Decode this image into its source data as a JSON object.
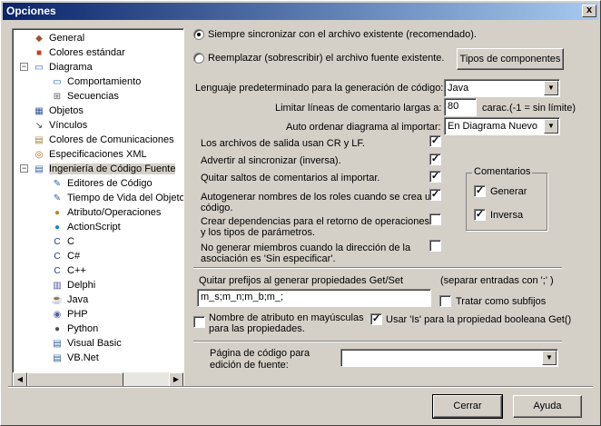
{
  "window": {
    "title": "Opciones",
    "close_glyph": "x"
  },
  "tree": {
    "items": [
      {
        "label": "General",
        "icon": "general-icon"
      },
      {
        "label": "Colores estándar",
        "icon": "colors-icon"
      },
      {
        "label": "Diagrama",
        "icon": "diagram-icon"
      },
      {
        "label": "Comportamiento",
        "icon": "behavior-icon"
      },
      {
        "label": "Secuencias",
        "icon": "sequence-icon"
      },
      {
        "label": "Objetos",
        "icon": "objects-icon"
      },
      {
        "label": "Vínculos",
        "icon": "links-icon"
      },
      {
        "label": "Colores de Comunicaciones",
        "icon": "comm-colors-icon"
      },
      {
        "label": "Especificaciones XML",
        "icon": "xml-icon"
      },
      {
        "label": "Ingeniería de Código Fuente",
        "icon": "code-engineering-icon"
      },
      {
        "label": "Editores de Código",
        "icon": "code-editor-icon"
      },
      {
        "label": "Tiempo de Vida del Objeto",
        "icon": "lifetime-icon"
      },
      {
        "label": "Atributo/Operaciones",
        "icon": "attribute-icon"
      },
      {
        "label": "ActionScript",
        "icon": "actionscript-icon"
      },
      {
        "label": "C",
        "icon": "c-icon"
      },
      {
        "label": "C#",
        "icon": "csharp-icon"
      },
      {
        "label": "C++",
        "icon": "cpp-icon"
      },
      {
        "label": "Delphi",
        "icon": "delphi-icon"
      },
      {
        "label": "Java",
        "icon": "java-icon"
      },
      {
        "label": "PHP",
        "icon": "php-icon"
      },
      {
        "label": "Python",
        "icon": "python-icon"
      },
      {
        "label": "Visual Basic",
        "icon": "vb-icon"
      },
      {
        "label": "VB.Net",
        "icon": "vbnet-icon"
      }
    ],
    "expander_minus": "−"
  },
  "glyphs": {
    "check": "✓",
    "arrow_left": "◀",
    "arrow_right": "▶",
    "arrow_down": "▼"
  },
  "sync": {
    "option1": "Siempre sincronizar con el archivo existente (recomendado).",
    "option2": "Reemplazar (sobrescribir) el archivo fuente existente.",
    "components_button": "Tipos de componentes"
  },
  "language": {
    "label": "Lenguaje predeterminado para la generación de código:",
    "value": "Java"
  },
  "long_comments": {
    "label": "Limitar líneas de comentario largas a:",
    "value": "80",
    "suffix": "carac.(-1 = sin límite)"
  },
  "auto_order": {
    "label": "Auto ordenar diagrama al importar:",
    "value": "En Diagrama Nuevo"
  },
  "checks": [
    {
      "label": "Los archivos de salida usan CR y LF.",
      "checked": true
    },
    {
      "label": "Advertir al sincronizar (inversa).",
      "checked": true
    },
    {
      "label": "Quitar saltos de comentarios al importar.",
      "checked": true
    },
    {
      "label1": "Autogenerar nombres de los roles cuando se crea un",
      "label2": "código.",
      "checked": true
    },
    {
      "label1": "Crear dependencias para el retorno de operaciones",
      "label2": "y los tipos de parámetros.",
      "checked": false
    },
    {
      "label1": "No generar miembros cuando la dirección de la",
      "label2": "asociación es 'Sin especificar'.",
      "checked": false
    }
  ],
  "comments_group": {
    "title": "Comentarios",
    "forward": "Generar",
    "reverse": "Inversa"
  },
  "prefixes": {
    "label": "Quitar prefijos al generar propiedades Get/Set",
    "hint": "(separar entradas con ';' )",
    "value": "m_s;m_n;m_b;m_;",
    "as_suffix": "Tratar como subfijos"
  },
  "uppercase_attr": {
    "label1": "Nombre de atributo en mayúsculas",
    "label2": "para las propiedades."
  },
  "use_is": "Usar 'Is' para la propiedad booleana Get()",
  "code_page": {
    "label1": "Página de código para",
    "label2": "edición de fuente:",
    "value": ""
  },
  "buttons": {
    "close": "Cerrar",
    "help": "Ayuda"
  }
}
